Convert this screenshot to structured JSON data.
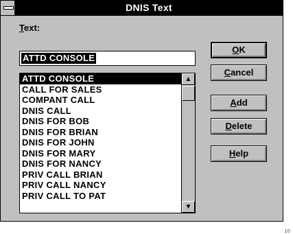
{
  "window": {
    "title": "DNIS Text",
    "sysmenu_icon": "system-menu-icon"
  },
  "text_field": {
    "label_accel": "T",
    "label_rest": "ext:",
    "value": "ATTD CONSOLE"
  },
  "list": {
    "items": [
      "ATTD CONSOLE",
      "CALL FOR SALES",
      "COMPANT CALL",
      "DNIS CALL",
      "DNIS FOR BOB",
      "DNIS FOR BRIAN",
      "DNIS FOR JOHN",
      "DNIS FOR MARY",
      "DNIS FOR NANCY",
      "PRIV CALL BRIAN",
      "PRIV CALL NANCY",
      "PRIV CALL TO PAT"
    ],
    "selected_index": 0,
    "scroll_up_icon": "arrow-up-icon",
    "scroll_down_icon": "arrow-down-icon"
  },
  "buttons": {
    "ok": {
      "accel": "O",
      "rest": "K"
    },
    "cancel": {
      "accel": "C",
      "rest": "ancel"
    },
    "add": {
      "accel": "A",
      "rest": "dd"
    },
    "delete": {
      "accel": "D",
      "rest": "elete"
    },
    "help": {
      "accel": "H",
      "rest": "elp"
    }
  },
  "footnote": "10"
}
